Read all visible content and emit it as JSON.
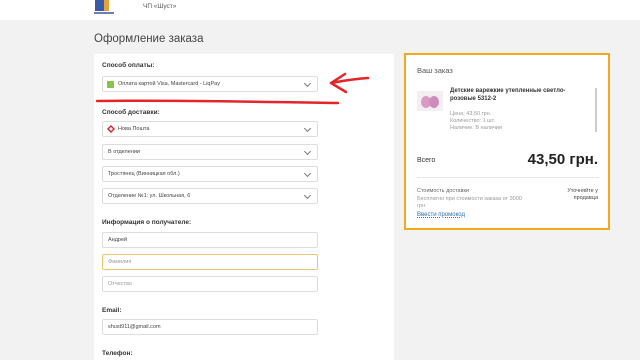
{
  "header": {
    "shop_name": "ЧП «Шуст»"
  },
  "page_title": "Оформление заказа",
  "payment": {
    "label": "Способ оплаты:",
    "selected": "Оплата картой Visa, Mastercard - LiqPay"
  },
  "delivery": {
    "label": "Способ доставки:",
    "carrier": "Нова Пошта",
    "type": "В отделении",
    "city": "Тростянец (Винницкая обл.)",
    "branch": "Отделение №1: ул. Школьная, 6"
  },
  "recipient": {
    "label": "Информация о получателе:",
    "first_name": "Андрей",
    "last_name_placeholder": "Фамилия",
    "patronymic_placeholder": "Отчество"
  },
  "email": {
    "label": "Email:",
    "value": "shust911@gmail.com"
  },
  "phone": {
    "label": "Телефон:"
  },
  "order": {
    "title": "Ваш заказ",
    "product_name": "Детские варежкие утепленные светло-розовые 5312-2",
    "price": "Цена: 43,50 грн.",
    "quantity": "Количество: 1 шт.",
    "availability": "Наличие: В наличии",
    "total_label": "Всего",
    "total_value": "43,50 грн.",
    "shipping_label": "Стоимость доставки",
    "shipping_free": "Бесплатно при стоимости заказа от 3000 грн",
    "shipping_calc": "Уточняйте у продавца",
    "promo_link": "Ввести промокод"
  },
  "colors": {
    "highlight_border": "#f2a91d",
    "annotation_red": "#e3252a",
    "link": "#2a6fb5"
  }
}
